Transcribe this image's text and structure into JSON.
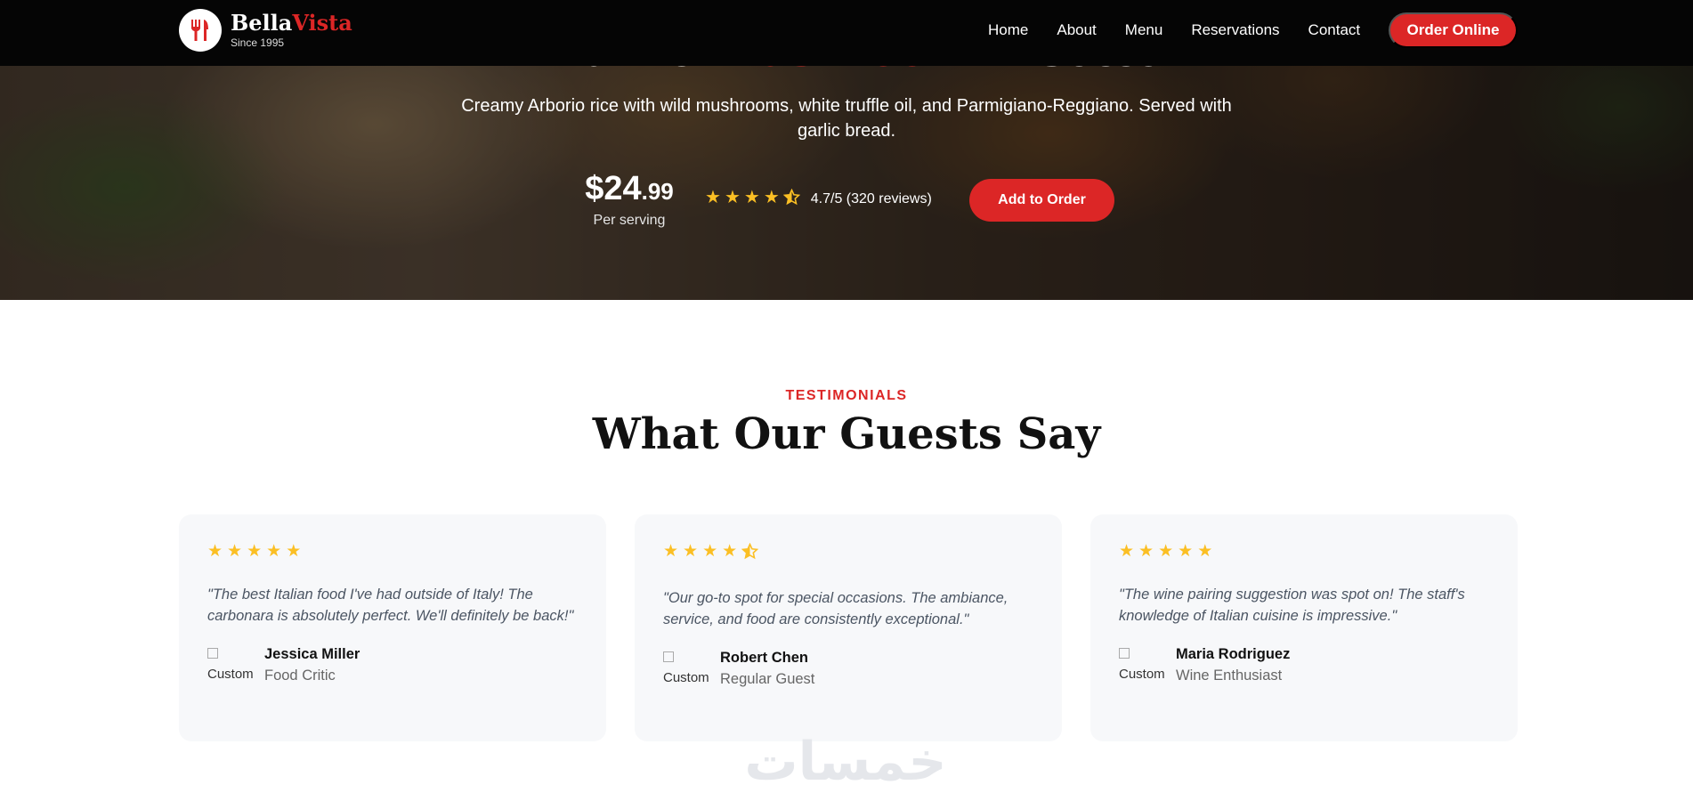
{
  "brand": {
    "name_part1": "Bella",
    "name_part2": "Vista",
    "since": "Since 1995",
    "accent_color": "#dc2626",
    "logo_icon": "fork-knife-icon"
  },
  "nav": {
    "links": [
      "Home",
      "About",
      "Menu",
      "Reservations",
      "Contact"
    ],
    "cta": "Order Online"
  },
  "hero": {
    "title_part1": "Truffle ",
    "title_accent": "Mushroom",
    "title_part2": " Risotto",
    "description": "Creamy Arborio rice with wild mushrooms, white truffle oil, and Parmigiano-Reggiano. Served with garlic bread.",
    "price_dollars": "$24",
    "price_cents": ".99",
    "price_unit": "Per serving",
    "rating_stars": 4.5,
    "rating_text": "4.7/5 (320 reviews)",
    "add_button": "Add to Order"
  },
  "testimonials": {
    "eyebrow": "TESTIMONIALS",
    "title": "What Our Guests Say",
    "star_color": "#fbbf24",
    "items": [
      {
        "stars": 5,
        "quote": "\"The best Italian food I've had outside of Italy! The carbonara is absolutely perfect. We'll definitely be back!\"",
        "avatar_alt": "Customer",
        "name": "Jessica Miller",
        "role": "Food Critic"
      },
      {
        "stars": 4.5,
        "quote": "\"Our go-to spot for special occasions. The ambiance, service, and food are consistently exceptional.\"",
        "avatar_alt": "Customer",
        "name": "Robert Chen",
        "role": "Regular Guest"
      },
      {
        "stars": 5,
        "quote": "\"The wine pairing suggestion was spot on! The staff's knowledge of Italian cuisine is impressive.\"",
        "avatar_alt": "Customer",
        "name": "Maria Rodriguez",
        "role": "Wine Enthusiast"
      }
    ]
  },
  "watermark": "خمسات"
}
